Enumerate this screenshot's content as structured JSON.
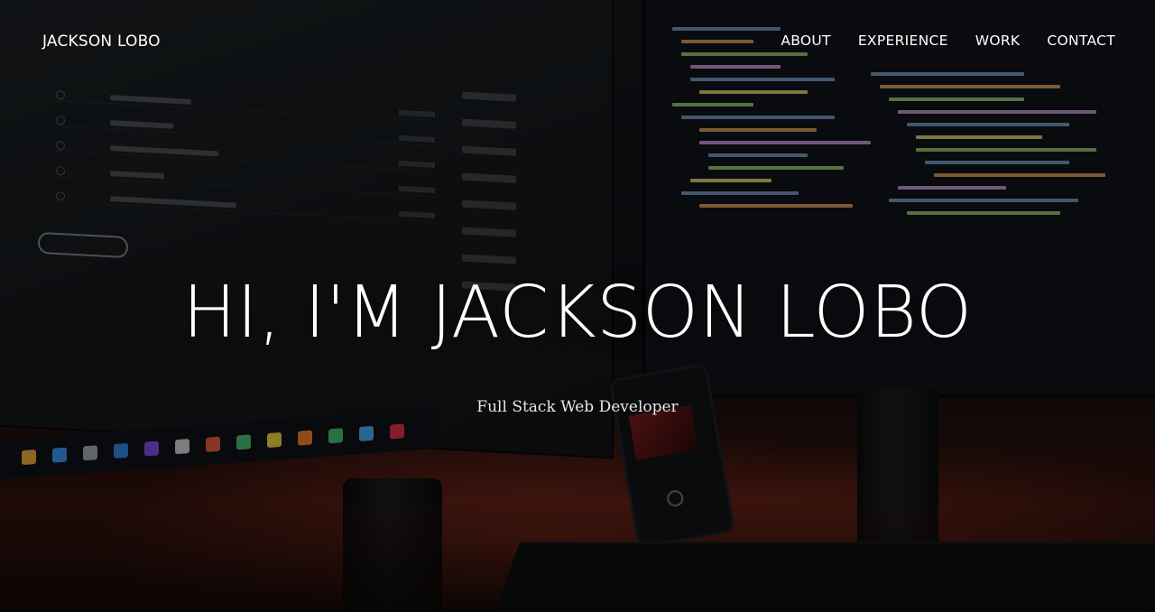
{
  "nav": {
    "brand": "JACKSON LOBO",
    "items": [
      {
        "label": "ABOUT"
      },
      {
        "label": "EXPERIENCE"
      },
      {
        "label": "WORK"
      },
      {
        "label": "CONTACT"
      }
    ]
  },
  "hero": {
    "headline": "HI, I'M JACKSON LOBO",
    "subtitle": "Full Stack Web Developer"
  },
  "colors": {
    "text": "#ffffff",
    "ambient_glow": "#b43c28",
    "background": "#0b0c0e"
  }
}
